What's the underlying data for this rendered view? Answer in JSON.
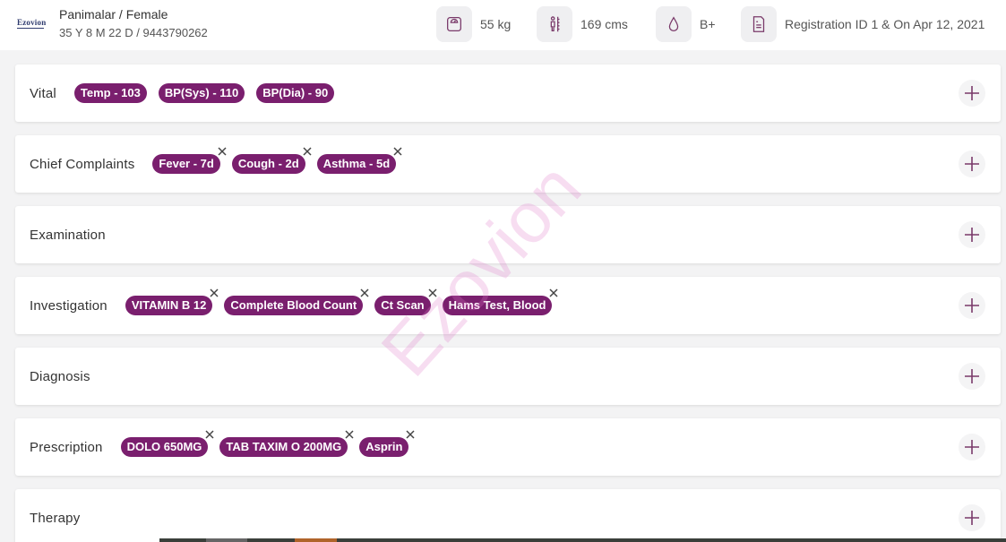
{
  "header": {
    "logo_text": "Ezovion",
    "patient_name": "Panimalar / Female",
    "patient_meta": "35 Y 8 M 22 D / 9443790262",
    "weight": "55 kg",
    "height": "169 cms",
    "blood_group": "B+",
    "registration": "Registration ID 1 & On Apr 12, 2021"
  },
  "watermark": "Ezovion",
  "sections": {
    "vital": {
      "title": "Vital",
      "chips": [
        "Temp - 103",
        "BP(Sys) - 110",
        "BP(Dia) - 90"
      ]
    },
    "chief_complaints": {
      "title": "Chief Complaints",
      "chips": [
        "Fever - 7d",
        "Cough - 2d",
        "Asthma - 5d"
      ]
    },
    "examination": {
      "title": "Examination"
    },
    "investigation": {
      "title": "Investigation",
      "chips": [
        "VITAMIN B 12",
        "Complete Blood Count",
        "Ct Scan",
        "Hams Test, Blood"
      ]
    },
    "diagnosis": {
      "title": "Diagnosis"
    },
    "prescription": {
      "title": "Prescription",
      "chips": [
        "DOLO 650MG",
        "TAB TAXIM O 200MG",
        "Asprin"
      ]
    },
    "therapy": {
      "title": "Therapy"
    }
  },
  "colors": {
    "chip_bg": "#7a1f6e",
    "plus_color": "#7a3a6a",
    "watermark": "#e178c8"
  },
  "icons": {
    "weight": "weighing-scale-icon",
    "height": "height-measure-icon",
    "blood": "blood-drop-icon",
    "registration": "document-icon",
    "add": "plus-icon",
    "remove": "close-icon"
  }
}
